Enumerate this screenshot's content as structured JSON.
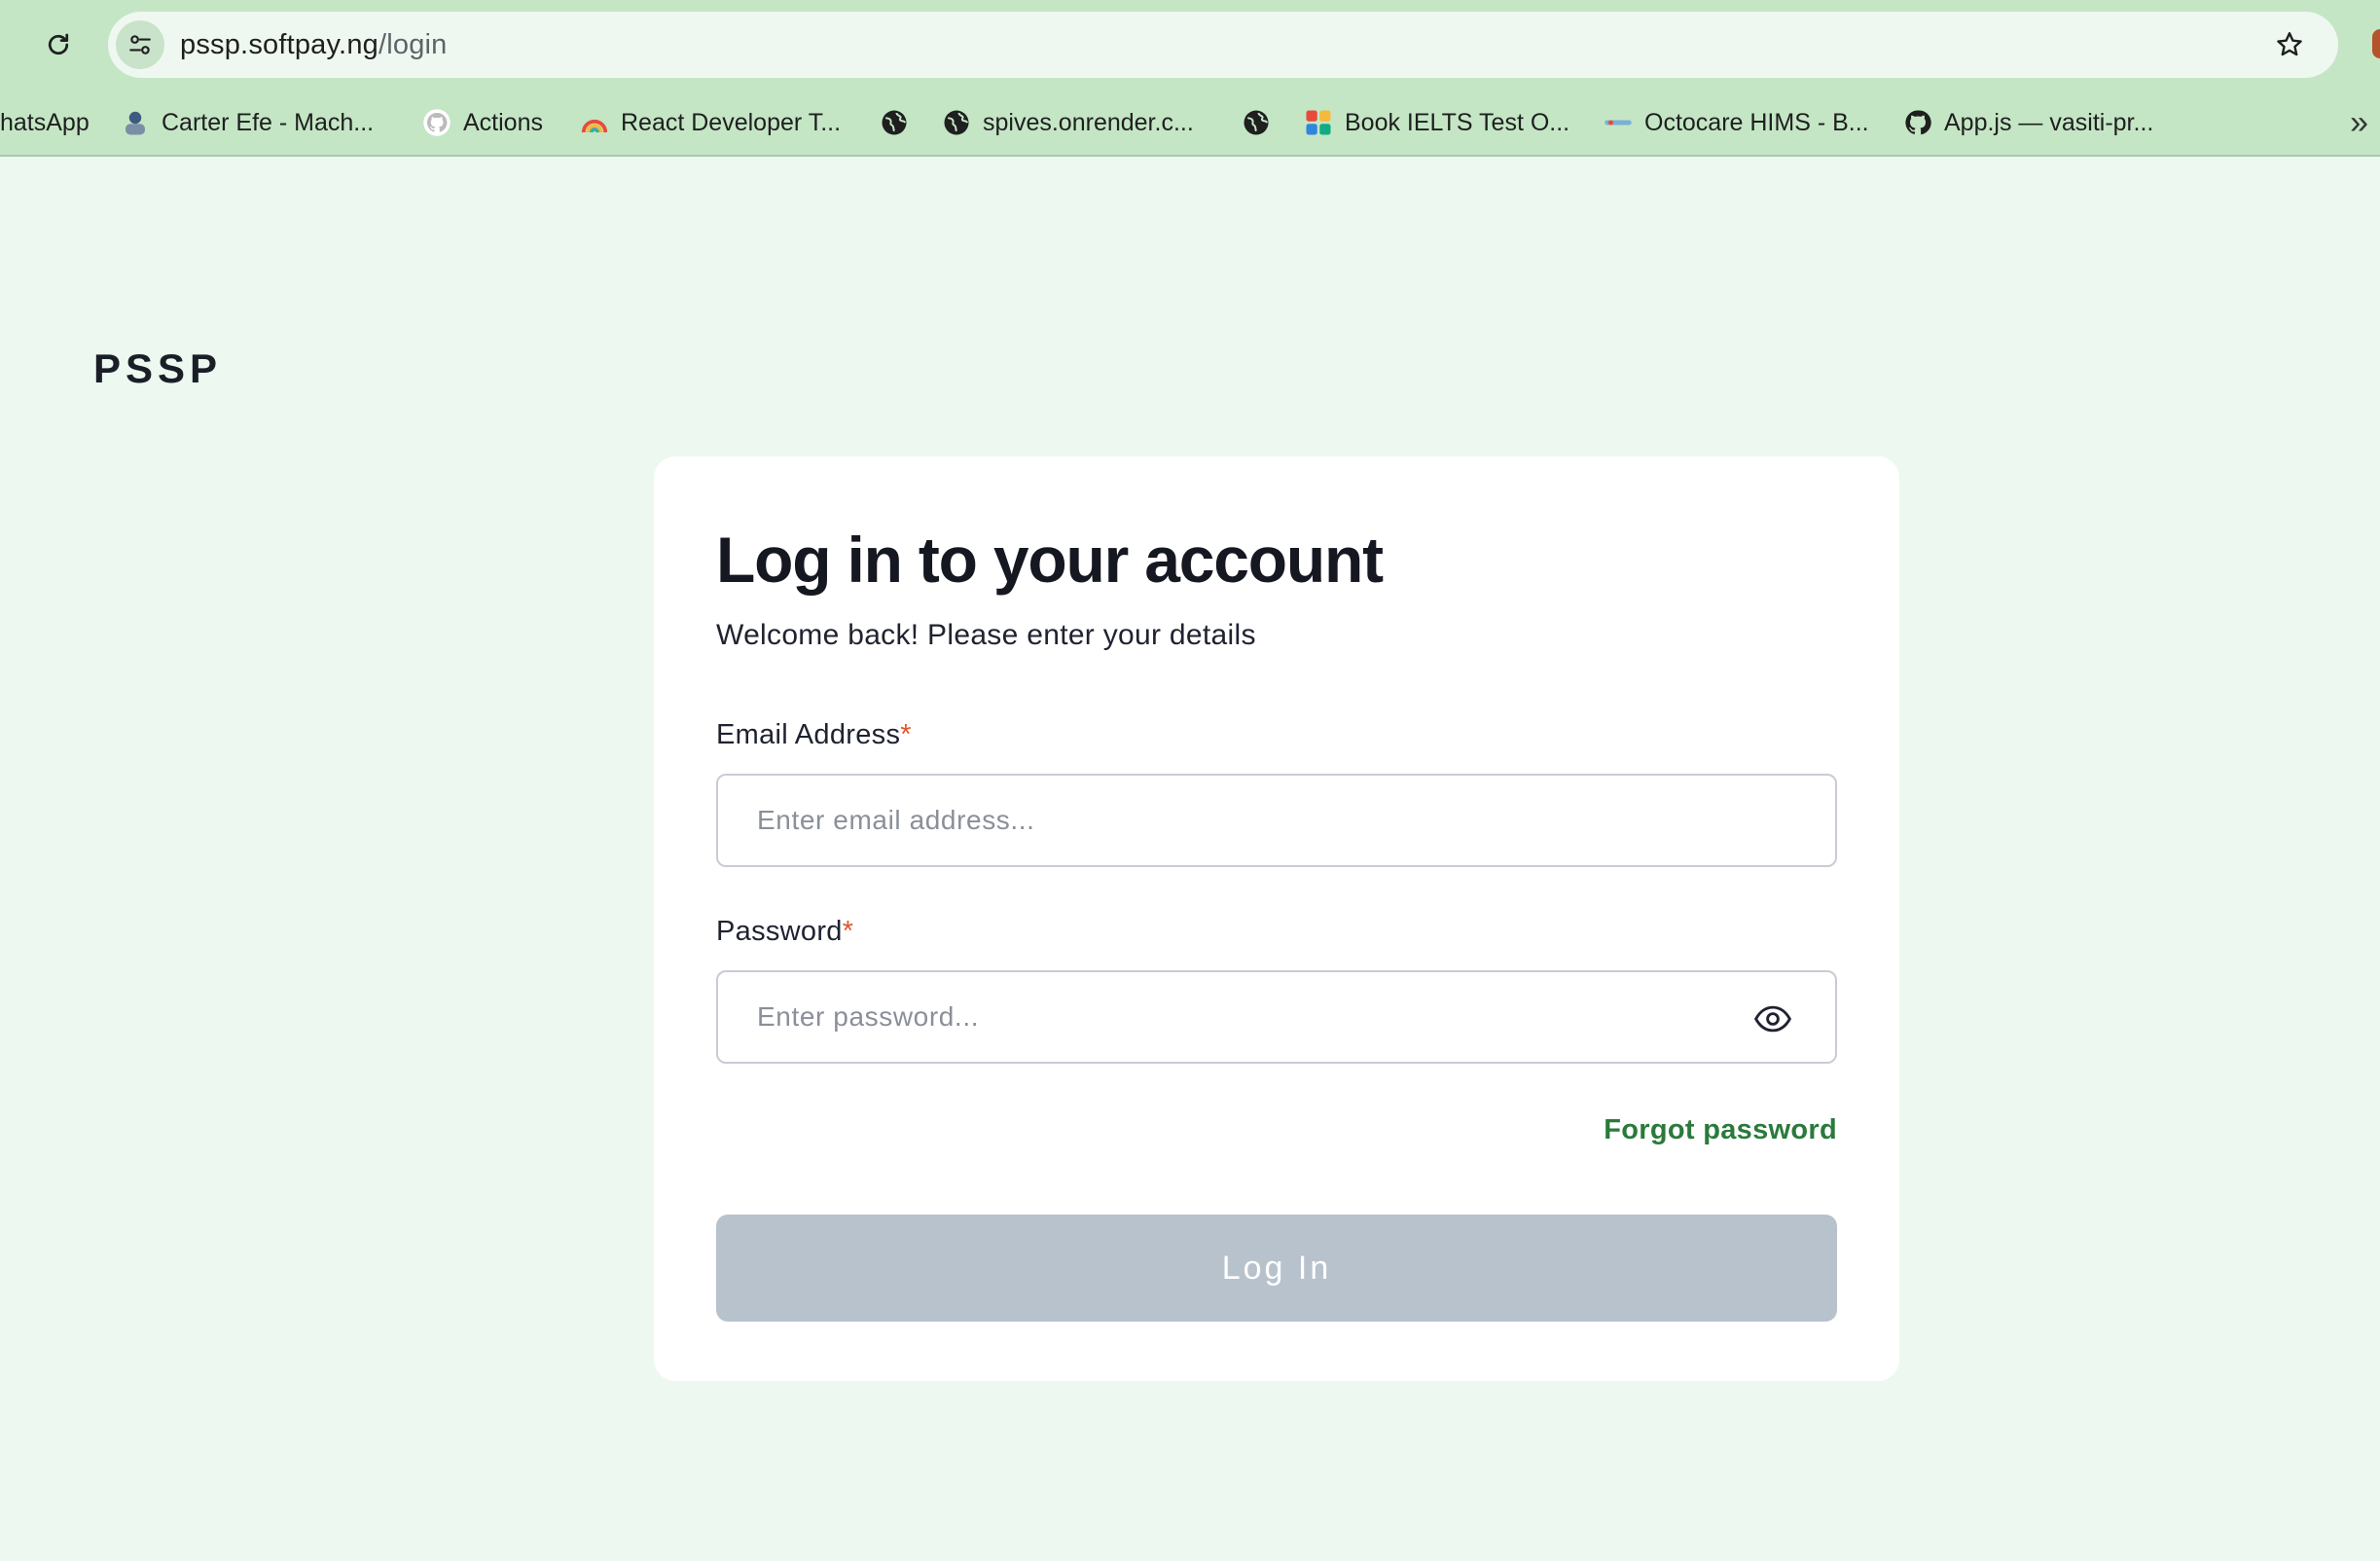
{
  "browser": {
    "url_host": "pssp.softpay.ng",
    "url_path": "/login",
    "bookmarks": [
      {
        "label": "hatsApp",
        "icon": "whatsapp-icon"
      },
      {
        "label": "Carter Efe - Mach...",
        "icon": "avatar-icon"
      },
      {
        "label": "Actions",
        "icon": "github-icon"
      },
      {
        "label": "React Developer T...",
        "icon": "rainbow-icon"
      },
      {
        "label": "",
        "icon": "globe-icon"
      },
      {
        "label": "spives.onrender.c...",
        "icon": "globe-icon"
      },
      {
        "label": "",
        "icon": "globe-icon"
      },
      {
        "label": "Book IELTS Test O...",
        "icon": "ielts-icon"
      },
      {
        "label": "Octocare HIMS - B...",
        "icon": "octocare-icon"
      },
      {
        "label": "App.js — vasiti-pr...",
        "icon": "github-icon"
      }
    ],
    "more_bookmarks_glyph": "»"
  },
  "page": {
    "logo": "PSSP",
    "title": "Log in to your account",
    "subtitle": "Welcome back! Please enter your details",
    "email": {
      "label": "Email Address",
      "required_mark": "*",
      "placeholder": "Enter email address...",
      "value": ""
    },
    "password": {
      "label": "Password",
      "required_mark": "*",
      "placeholder": "Enter password...",
      "value": ""
    },
    "forgot_password": "Forgot password",
    "login_button": "Log In"
  },
  "colors": {
    "page_bg": "#ecf8f0",
    "chrome_bg": "#c4e6c5",
    "accent_green": "#2a7a3b",
    "required": "#e2552a",
    "button_disabled": "#b8c2cd"
  }
}
